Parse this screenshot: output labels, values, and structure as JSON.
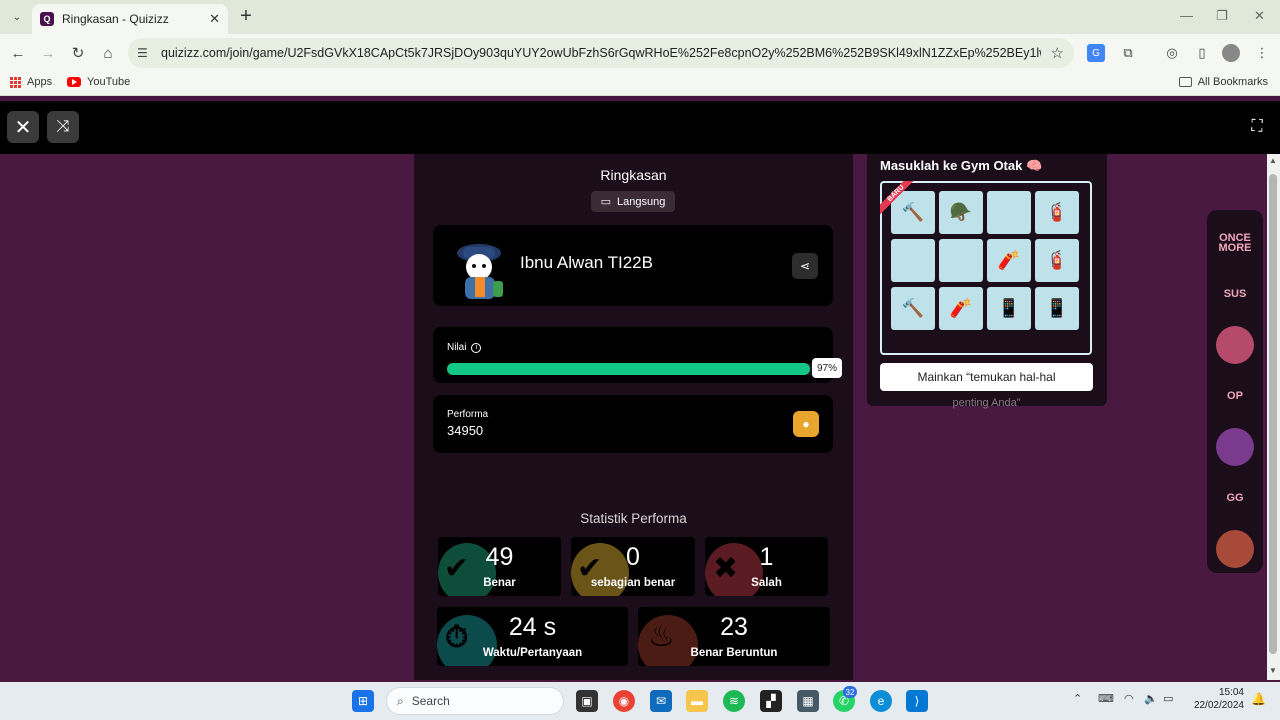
{
  "browser": {
    "tab_title": "Ringkasan - Quizizz",
    "url": "quizizz.com/join/game/U2FsdGVkX18CApCt5k7JRSjDOy903quYUY2owUbFzhS6rGqwRHoE%252Fe8cpnO2y%252BM6%252B9SKl49xlN1ZZxEp%252BEy1lw%253D%253D?...",
    "bookmarks": [
      "Apps",
      "YouTube"
    ],
    "all_bookmarks_label": "All Bookmarks"
  },
  "summary": {
    "title": "Ringkasan",
    "mode_label": "Langsung",
    "player_name": "Ibnu Alwan TI22B",
    "score_label": "Nilai",
    "score_percent": 97,
    "score_percent_label": "97%",
    "performance_label": "Performa",
    "performance_value": "34950",
    "stats_title": "Statistik Performa",
    "stats": [
      {
        "value": "49",
        "label": "Benar",
        "color": "#0d4d3a",
        "glyph_color": "#000"
      },
      {
        "value": "0",
        "label": "sebagian benar",
        "color": "#6b5418",
        "glyph_color": "#000"
      },
      {
        "value": "1",
        "label": "Salah",
        "color": "#5a1b22",
        "glyph_color": "#000"
      },
      {
        "value": "24 s",
        "label": "Waktu/Pertanyaan",
        "color": "#0b4b4b",
        "glyph_color": "#000"
      },
      {
        "value": "23",
        "label": "Benar Beruntun",
        "color": "#4a1c14",
        "glyph_color": "#000"
      }
    ]
  },
  "gym": {
    "title": "Masuklah ke Gym Otak 🧠",
    "ribbon": "BARU",
    "tiles": [
      "🔨",
      "🪖",
      "",
      "🧯",
      "",
      "",
      "🧨",
      "🧯",
      "🔨",
      "🧨",
      "📱",
      "📱"
    ],
    "play_label": "Mainkan “temukan hal-hal",
    "play_overflow": "penting Anda”"
  },
  "rail": [
    "ONCE MORE",
    "SUS",
    "",
    "OP",
    "",
    "GG",
    ""
  ],
  "taskbar": {
    "search_placeholder": "Search",
    "whatsapp_badge": "32",
    "time": "15:04",
    "date": "22/02/2024"
  },
  "colors": {
    "page_bg": "#4a1942",
    "panel_bg": "#1b0d1a",
    "progress": "#13c789"
  }
}
